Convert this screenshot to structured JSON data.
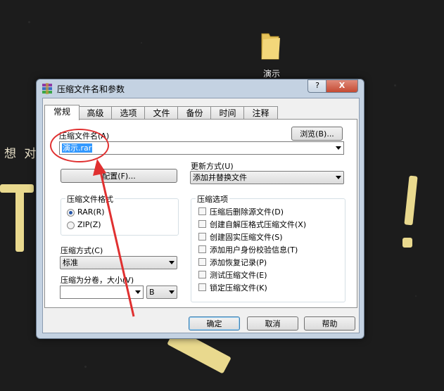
{
  "desktop": {
    "folder_label": "演示",
    "left_text": "想 对"
  },
  "window": {
    "title": "压缩文件名和参数",
    "help_button": "?",
    "close_button": "X",
    "tabs": [
      "常规",
      "高级",
      "选项",
      "文件",
      "备份",
      "时间",
      "注释"
    ],
    "active_tab": "常规",
    "archive_name_label": "压缩文件名(A)",
    "browse_button": "浏览(B)...",
    "archive_name_value": "演示.rar",
    "profiles_button": "配置(F)...",
    "update_mode_label": "更新方式(U)",
    "update_mode_value": "添加并替换文件",
    "format_group_title": "压缩文件格式",
    "format_options": [
      {
        "label": "RAR(R)",
        "selected": true
      },
      {
        "label": "ZIP(Z)",
        "selected": false
      }
    ],
    "options_group_title": "压缩选项",
    "options": [
      "压缩后删除源文件(D)",
      "创建自解压格式压缩文件(X)",
      "创建固实压缩文件(S)",
      "添加用户身份校验信息(T)",
      "添加恢复记录(P)",
      "测试压缩文件(E)",
      "锁定压缩文件(K)"
    ],
    "method_label": "压缩方式(C)",
    "method_value": "标准",
    "split_label": "压缩为分卷，大小(V)",
    "split_value": "",
    "split_unit": "B",
    "ok_button": "确定",
    "cancel_button": "取消",
    "help_button_bottom": "帮助"
  },
  "colors": {
    "annotation": "#e03030",
    "selection": "#3399ff"
  }
}
